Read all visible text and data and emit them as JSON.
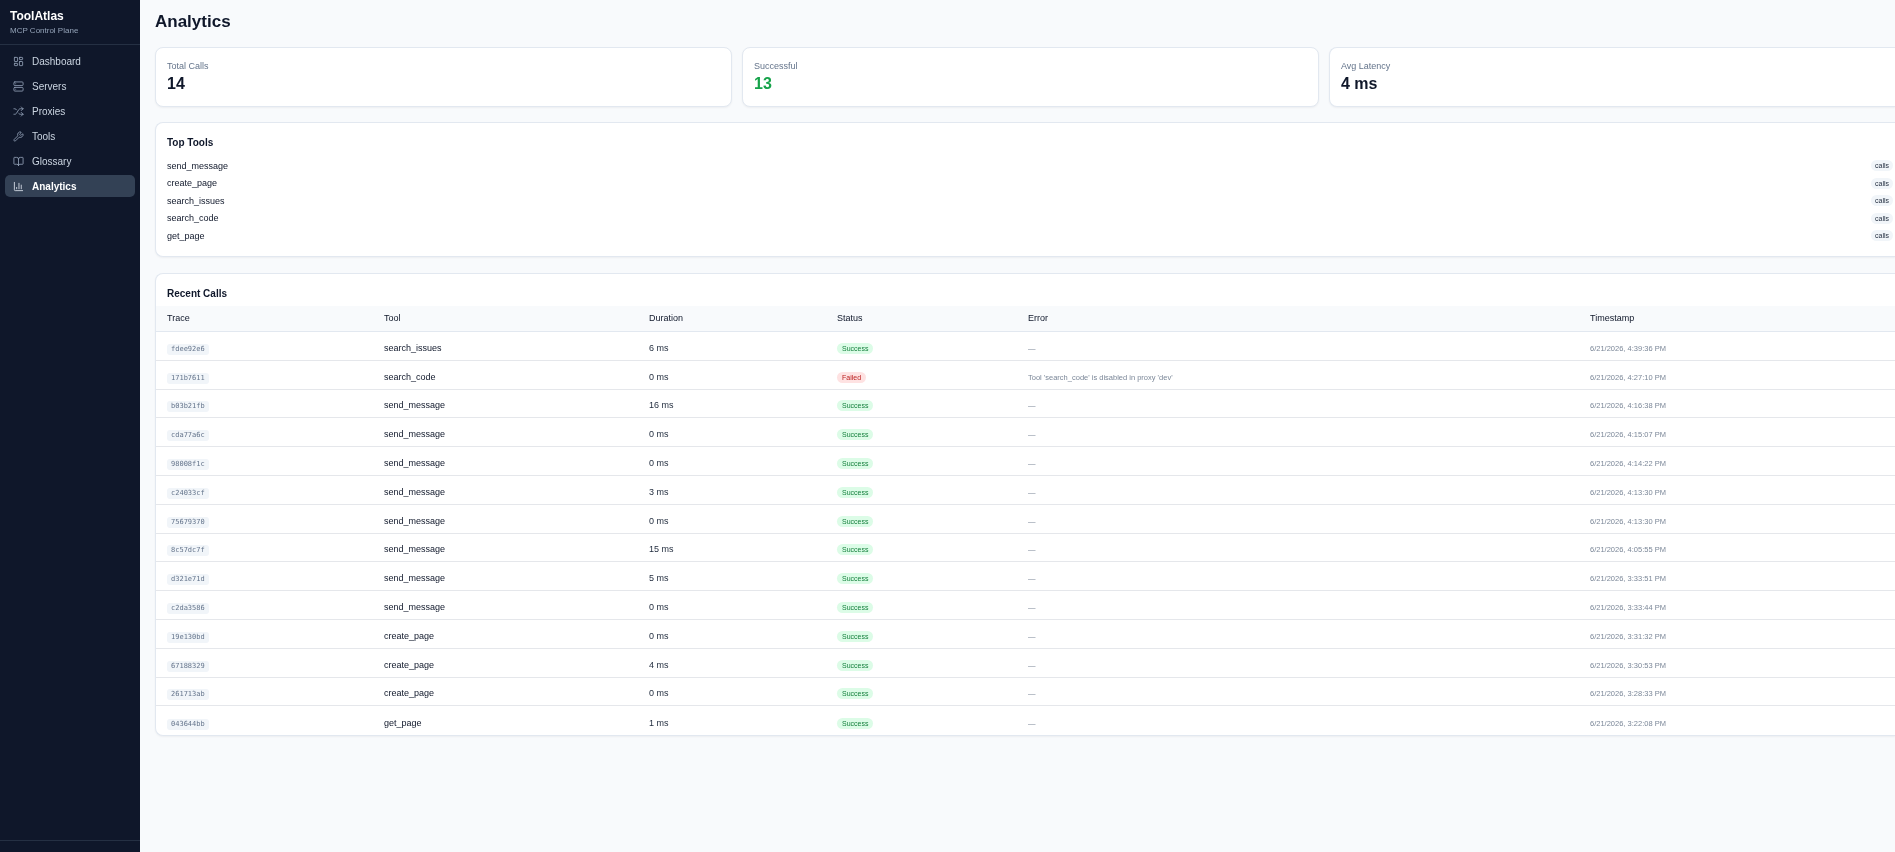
{
  "sidebar": {
    "brand": "ToolAtlas",
    "subtitle": "MCP Control Plane",
    "items": [
      {
        "label": "Dashboard",
        "selected": false
      },
      {
        "label": "Servers",
        "selected": false
      },
      {
        "label": "Proxies",
        "selected": false
      },
      {
        "label": "Tools",
        "selected": false
      },
      {
        "label": "Glossary",
        "selected": false
      },
      {
        "label": "Analytics",
        "selected": true
      }
    ]
  },
  "page": {
    "title": "Analytics"
  },
  "stats": [
    {
      "label": "Total Calls",
      "value": "14",
      "kind": "plain"
    },
    {
      "label": "Successful",
      "value": "13",
      "kind": "success"
    },
    {
      "label": "Avg Latency",
      "value": "4 ms",
      "kind": "plain"
    }
  ],
  "top_tools": {
    "title": "Top Tools",
    "items": [
      {
        "name": "send_message",
        "badge": "calls"
      },
      {
        "name": "create_page",
        "badge": "calls"
      },
      {
        "name": "search_issues",
        "badge": "calls"
      },
      {
        "name": "search_code",
        "badge": "calls"
      },
      {
        "name": "get_page",
        "badge": "calls"
      }
    ]
  },
  "recent_calls": {
    "title": "Recent Calls",
    "columns": [
      "Trace",
      "Tool",
      "Duration",
      "Status",
      "Error",
      "Timestamp"
    ],
    "rows": [
      {
        "trace": "fdee92e6",
        "tool": "search_issues",
        "duration": "6 ms",
        "status": {
          "text": "Success",
          "kind": "success"
        },
        "error": "—",
        "timestamp": "6/21/2026, 4:39:36 PM"
      },
      {
        "trace": "171b7611",
        "tool": "search_code",
        "duration": "0 ms",
        "status": {
          "text": "Failed",
          "kind": "failed"
        },
        "error": "Tool 'search_code' is disabled in proxy 'dev'",
        "timestamp": "6/21/2026, 4:27:10 PM"
      },
      {
        "trace": "b03b21fb",
        "tool": "send_message",
        "duration": "16 ms",
        "status": {
          "text": "Success",
          "kind": "success"
        },
        "error": "—",
        "timestamp": "6/21/2026, 4:16:38 PM"
      },
      {
        "trace": "cda77a6c",
        "tool": "send_message",
        "duration": "0 ms",
        "status": {
          "text": "Success",
          "kind": "success"
        },
        "error": "—",
        "timestamp": "6/21/2026, 4:15:07 PM"
      },
      {
        "trace": "98008f1c",
        "tool": "send_message",
        "duration": "0 ms",
        "status": {
          "text": "Success",
          "kind": "success"
        },
        "error": "—",
        "timestamp": "6/21/2026, 4:14:22 PM"
      },
      {
        "trace": "c24033cf",
        "tool": "send_message",
        "duration": "3 ms",
        "status": {
          "text": "Success",
          "kind": "success"
        },
        "error": "—",
        "timestamp": "6/21/2026, 4:13:30 PM"
      },
      {
        "trace": "75679370",
        "tool": "send_message",
        "duration": "0 ms",
        "status": {
          "text": "Success",
          "kind": "success"
        },
        "error": "—",
        "timestamp": "6/21/2026, 4:13:30 PM"
      },
      {
        "trace": "8c57dc7f",
        "tool": "send_message",
        "duration": "15 ms",
        "status": {
          "text": "Success",
          "kind": "success"
        },
        "error": "—",
        "timestamp": "6/21/2026, 4:05:55 PM"
      },
      {
        "trace": "d321e71d",
        "tool": "send_message",
        "duration": "5 ms",
        "status": {
          "text": "Success",
          "kind": "success"
        },
        "error": "—",
        "timestamp": "6/21/2026, 3:33:51 PM"
      },
      {
        "trace": "c2da3586",
        "tool": "send_message",
        "duration": "0 ms",
        "status": {
          "text": "Success",
          "kind": "success"
        },
        "error": "—",
        "timestamp": "6/21/2026, 3:33:44 PM"
      },
      {
        "trace": "19e130bd",
        "tool": "create_page",
        "duration": "0 ms",
        "status": {
          "text": "Success",
          "kind": "success"
        },
        "error": "—",
        "timestamp": "6/21/2026, 3:31:32 PM"
      },
      {
        "trace": "67188329",
        "tool": "create_page",
        "duration": "4 ms",
        "status": {
          "text": "Success",
          "kind": "success"
        },
        "error": "—",
        "timestamp": "6/21/2026, 3:30:53 PM"
      },
      {
        "trace": "261713ab",
        "tool": "create_page",
        "duration": "0 ms",
        "status": {
          "text": "Success",
          "kind": "success"
        },
        "error": "—",
        "timestamp": "6/21/2026, 3:28:33 PM"
      },
      {
        "trace": "043644bb",
        "tool": "get_page",
        "duration": "1 ms",
        "status": {
          "text": "Success",
          "kind": "success"
        },
        "error": "—",
        "timestamp": "6/21/2026, 3:22:08 PM"
      }
    ]
  }
}
